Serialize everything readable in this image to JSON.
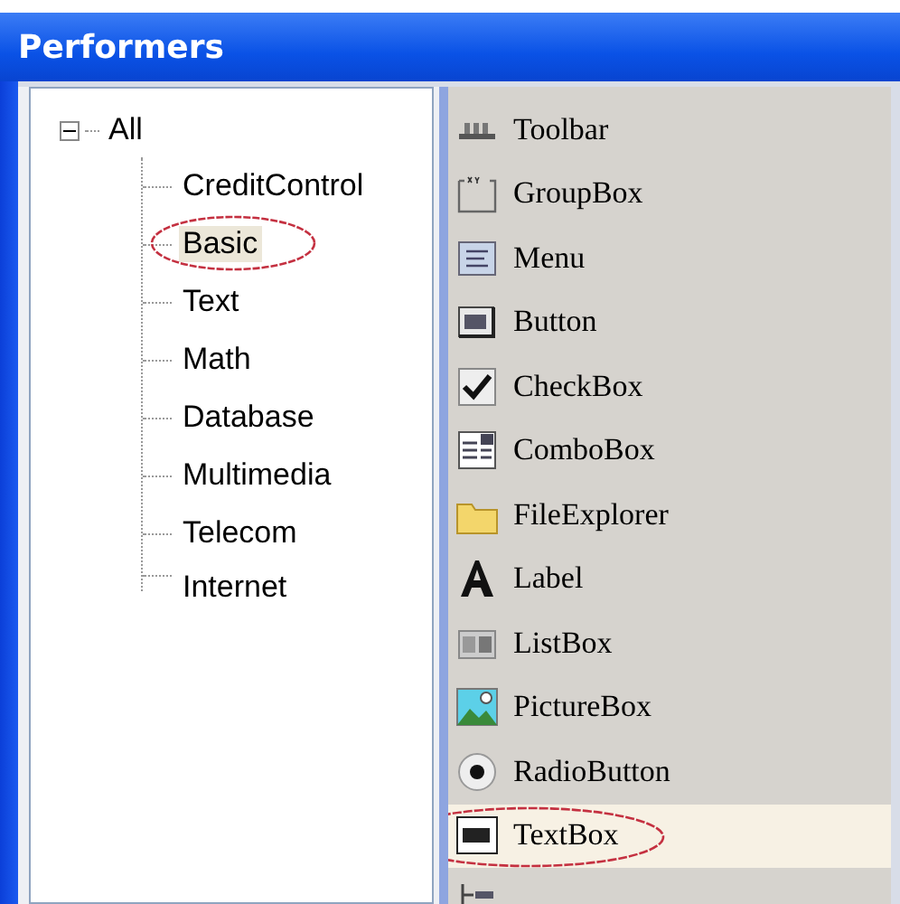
{
  "window": {
    "title": "Performers"
  },
  "tree": {
    "label": "All",
    "expanded": true,
    "children": [
      {
        "label": "CreditControl",
        "selected": false,
        "circled": false
      },
      {
        "label": "Basic",
        "selected": true,
        "circled": true
      },
      {
        "label": "Text",
        "selected": false,
        "circled": false
      },
      {
        "label": "Math",
        "selected": false,
        "circled": false
      },
      {
        "label": "Database",
        "selected": false,
        "circled": false
      },
      {
        "label": "Multimedia",
        "selected": false,
        "circled": false
      },
      {
        "label": "Telecom",
        "selected": false,
        "circled": false
      },
      {
        "label": "Internet",
        "selected": false,
        "circled": false
      }
    ]
  },
  "components": [
    {
      "label": "Toolbar",
      "kind": "toolbar",
      "selected": false,
      "circled": false
    },
    {
      "label": "GroupBox",
      "kind": "groupbox",
      "selected": false,
      "circled": false
    },
    {
      "label": "Menu",
      "kind": "menu",
      "selected": false,
      "circled": false
    },
    {
      "label": "Button",
      "kind": "button",
      "selected": false,
      "circled": false
    },
    {
      "label": "CheckBox",
      "kind": "checkbox",
      "selected": false,
      "circled": false
    },
    {
      "label": "ComboBox",
      "kind": "combobox",
      "selected": false,
      "circled": false
    },
    {
      "label": "FileExplorer",
      "kind": "folder",
      "selected": false,
      "circled": false
    },
    {
      "label": "Label",
      "kind": "label",
      "selected": false,
      "circled": false
    },
    {
      "label": "ListBox",
      "kind": "listbox",
      "selected": false,
      "circled": false
    },
    {
      "label": "PictureBox",
      "kind": "picture",
      "selected": false,
      "circled": false
    },
    {
      "label": "RadioButton",
      "kind": "radio",
      "selected": false,
      "circled": false
    },
    {
      "label": "TextBox",
      "kind": "textbox",
      "selected": true,
      "circled": true
    },
    {
      "kind": "treeview",
      "selected": false,
      "circled": false
    }
  ]
}
